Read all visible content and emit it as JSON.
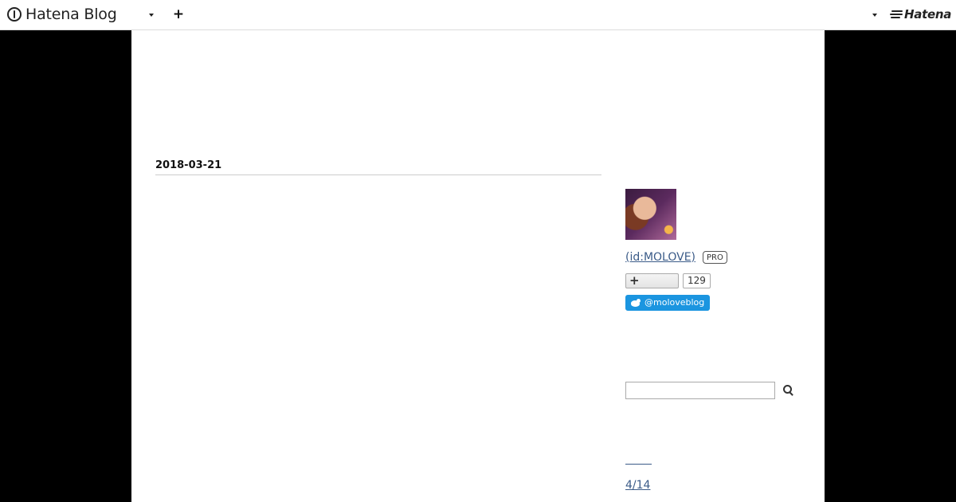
{
  "topbar": {
    "brand": "Hatena Blog",
    "hatena_logo": "Hatena",
    "add_icon": "plus-icon",
    "blog_menu_icon": "caret-down-icon",
    "user_menu_icon": "caret-down-icon"
  },
  "colors": {
    "page_background": "#000000",
    "content_background": "#ffffff",
    "link": "#3b5b88",
    "twitter": "#1b95e0"
  },
  "main": {
    "archive_date": "2018-03-21"
  },
  "sidebar": {
    "profile": {
      "id_label": " (id:MOLOVE)",
      "pro_badge": "PRO",
      "avatar_icon": "profile-avatar"
    },
    "subscribe": {
      "count": "129",
      "icon": "plus-icon"
    },
    "twitter": {
      "handle": "@moloveblog",
      "icon": "twitter-bird-icon"
    },
    "search": {
      "placeholder": "",
      "value": "",
      "icon": "search-icon"
    },
    "recent": {
      "items": [
        "4/14 "
      ]
    }
  }
}
